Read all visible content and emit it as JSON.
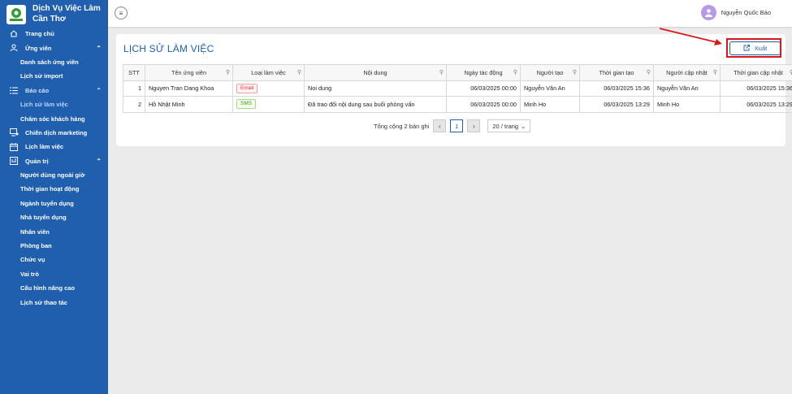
{
  "sidebar": {
    "brand_line1": "Dịch Vụ Việc Làm",
    "brand_line2": "Cần Thơ",
    "items": [
      {
        "label": "Trang chủ"
      },
      {
        "label": "Ứng viên"
      },
      {
        "label": "Danh sách ứng viên"
      },
      {
        "label": "Lịch sử import"
      },
      {
        "label": "Báo cáo"
      },
      {
        "label": "Lịch sử làm việc"
      },
      {
        "label": "Chăm sóc khách hàng"
      },
      {
        "label": "Chiến dịch marketing"
      },
      {
        "label": "Lịch làm việc"
      },
      {
        "label": "Quản trị"
      },
      {
        "label": "Người dùng ngoài giờ"
      },
      {
        "label": "Thời gian hoạt động"
      },
      {
        "label": "Ngành tuyển dụng"
      },
      {
        "label": "Nhà tuyển dụng"
      },
      {
        "label": "Nhân viên"
      },
      {
        "label": "Phòng ban"
      },
      {
        "label": "Chức vụ"
      },
      {
        "label": "Vai trò"
      },
      {
        "label": "Cấu hình nâng cao"
      },
      {
        "label": "Lịch sử thao tác"
      }
    ]
  },
  "header": {
    "user_name": "Nguyễn Quốc Bảo"
  },
  "main": {
    "title": "LỊCH SỬ LÀM VIỆC",
    "export_label": "Xuất",
    "columns": [
      "STT",
      "Tên ứng viên",
      "Loại làm việc",
      "Nội dung",
      "Ngày tác động",
      "Người tạo",
      "Thời gian tạo",
      "Người cập nhật",
      "Thời gian cập nhật"
    ],
    "rows": [
      {
        "stt": "1",
        "name": "Nguyen Tran Dang Khoa",
        "type": "Email",
        "content": "Noi dung",
        "date": "06/03/2025 00:00",
        "creator": "Nguyễn Văn An",
        "created": "06/03/2025 15:36",
        "updater": "Nguyễn Văn An",
        "updated": "06/03/2025 15:36"
      },
      {
        "stt": "2",
        "name": "Hồ Nhật Minh",
        "type": "SMS",
        "content": "Đã trao đổi nội dung sau buổi phỏng vấn",
        "date": "06/03/2025 00:00",
        "creator": "Minh Ho",
        "created": "06/03/2025 13:29",
        "updater": "Minh Ho",
        "updated": "06/03/2025 13:29"
      }
    ],
    "pagination": {
      "total_text": "Tổng cộng 2 bản ghi",
      "current_page": "1",
      "page_size": "20 / trang"
    }
  },
  "colors": {
    "sidebar_bg": "#1f5fae",
    "accent": "#1f5fae",
    "highlight": "#d9181b"
  }
}
